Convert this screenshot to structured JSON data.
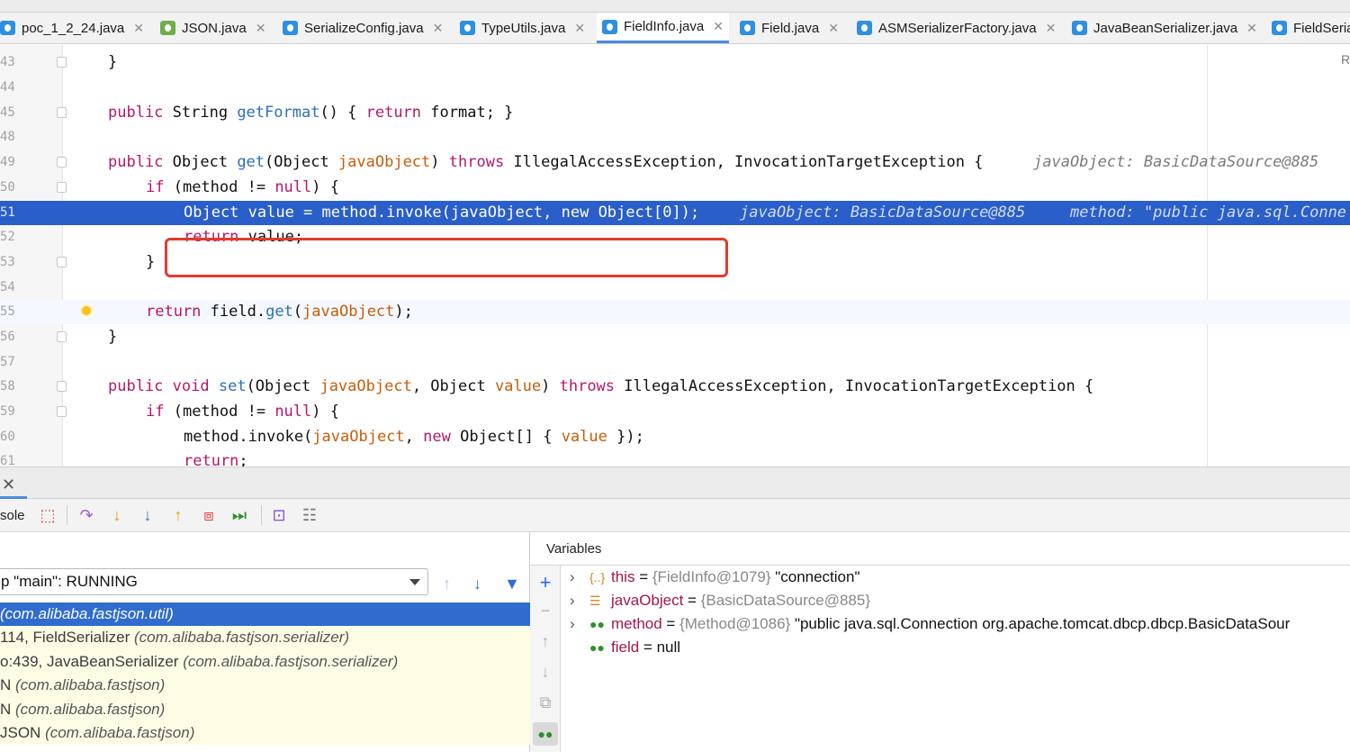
{
  "tabs": [
    {
      "label": "poc_1_2_24.java",
      "icon": "class-icon"
    },
    {
      "label": "JSON.java",
      "icon": "interface-icon"
    },
    {
      "label": "SerializeConfig.java",
      "icon": "class-icon"
    },
    {
      "label": "TypeUtils.java",
      "icon": "class-icon"
    },
    {
      "label": "FieldInfo.java",
      "icon": "class-icon"
    },
    {
      "label": "Field.java",
      "icon": "class-icon"
    },
    {
      "label": "ASMSerializerFactory.java",
      "icon": "class-icon"
    },
    {
      "label": "JavaBeanSerializer.java",
      "icon": "class-icon"
    },
    {
      "label": "FieldSeria",
      "icon": "class-icon"
    }
  ],
  "editor": {
    "lines": [
      {
        "num": "43",
        "code": "}"
      },
      {
        "num": "44",
        "code": ""
      },
      {
        "num": "45",
        "pre": "public ",
        "t1": "String ",
        "fn": "getFormat",
        "post": "() { ",
        "kw": "return",
        "rest": " format; }"
      },
      {
        "num": "48",
        "code": ""
      },
      {
        "num": "49",
        "kw1": "public ",
        "t1": "Object ",
        "fn": "get",
        "p1": "(Object ",
        "param": "javaObject",
        "p2": ") ",
        "kw2": "throws",
        "rest": " IllegalAccessException, InvocationTargetException {",
        "hint": "javaObject: BasicDataSource@885"
      },
      {
        "num": "50",
        "kw": "if",
        "rest": " (method != ",
        "kw2": "null",
        "rest2": ") {"
      },
      {
        "num": "51",
        "code": "Object value = method.invoke(javaObject, new Object[0]);",
        "hint1": "javaObject: BasicDataSource@885",
        "hint2": "method: \"public java.sql.Conne"
      },
      {
        "num": "52",
        "kw": "return",
        "rest": " value;"
      },
      {
        "num": "53",
        "code": "}"
      },
      {
        "num": "54",
        "code": ""
      },
      {
        "num": "55",
        "kw": "return",
        "rest": " field.",
        "fn": "get",
        "p": "(",
        "param": "javaObject",
        "end": ");"
      },
      {
        "num": "56",
        "code": "}"
      },
      {
        "num": "57",
        "code": ""
      },
      {
        "num": "58",
        "kw1": "public ",
        "kw1b": "void ",
        "fn": "set",
        "p1": "(Object ",
        "param1": "javaObject",
        "p2": ", Object ",
        "param2": "value",
        "p3": ") ",
        "kw2": "throws",
        "rest": " IllegalAccessException, InvocationTargetException {"
      },
      {
        "num": "59",
        "kw": "if",
        "rest": " (method != ",
        "kw2": "null",
        "rest2": ") {"
      },
      {
        "num": "60",
        "pre": "method.invoke(",
        "param1": "javaObject",
        "mid": ", ",
        "kw": "new",
        "mid2": " Object[] { ",
        "param2": "value",
        "end": " });"
      },
      {
        "num": "61",
        "kw": "return",
        "rest": ";"
      }
    ],
    "right_marker": "R"
  },
  "debug": {
    "toolbar_label": "sole",
    "thread_select": "p \"main\": RUNNING",
    "frames": [
      {
        "text": "(com.alibaba.fastjson.util)",
        "selected": true
      },
      {
        "text": "114, FieldSerializer ",
        "pkg": "(com.alibaba.fastjson.serializer)"
      },
      {
        "text": "o:439, JavaBeanSerializer ",
        "pkg": "(com.alibaba.fastjson.serializer)"
      },
      {
        "text": "N ",
        "pkg": "(com.alibaba.fastjson)"
      },
      {
        "text": "N ",
        "pkg": "(com.alibaba.fastjson)"
      },
      {
        "text": "JSON ",
        "pkg": "(com.alibaba.fastjson)"
      }
    ],
    "variables_title": "Variables",
    "variables": [
      {
        "name": "this",
        "eq": " = ",
        "type": "{FieldInfo@1079}",
        "value": " \"connection\"",
        "icon": "object-icon"
      },
      {
        "name": "javaObject",
        "eq": " = ",
        "type": "{BasicDataSource@885}",
        "value": "",
        "icon": "field-icon"
      },
      {
        "name": "method",
        "eq": " = ",
        "type": "{Method@1086}",
        "value": " \"public java.sql.Connection org.apache.tomcat.dbcp.dbcp.BasicDataSour",
        "icon": "watch-icon"
      },
      {
        "name": "field",
        "eq": " = ",
        "type": "",
        "value": "null",
        "icon": "watch-icon"
      }
    ]
  },
  "colors": {
    "highlight": "#2a5ec9",
    "keyword": "#b5176a",
    "frame_selected": "#2f6cce",
    "box": "#e23b2e"
  }
}
